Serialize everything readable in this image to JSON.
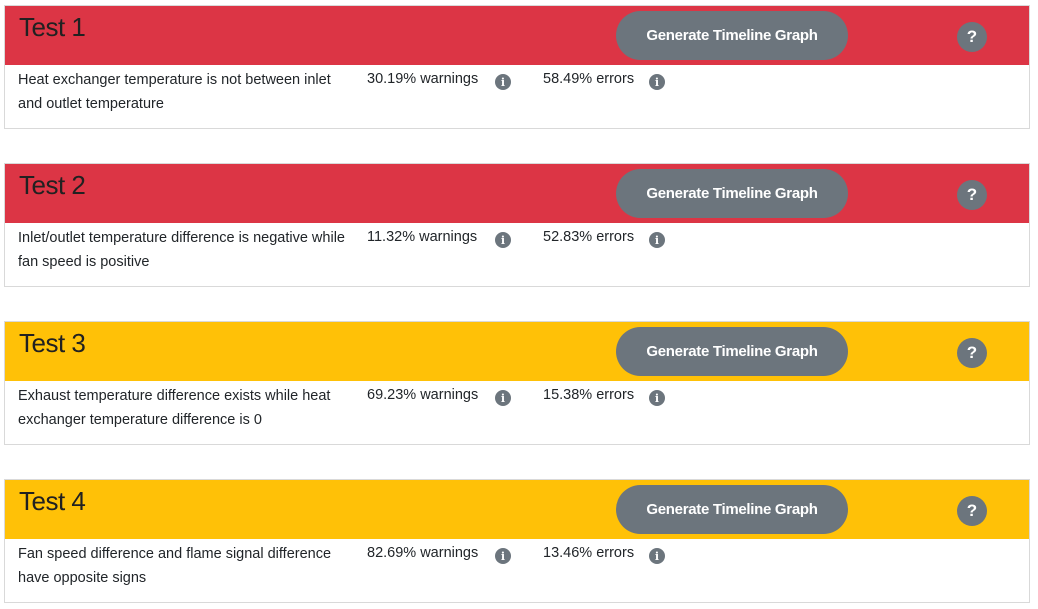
{
  "tests": [
    {
      "title": "Test 1",
      "color": "#dc3545",
      "button_label": "Generate Timeline Graph",
      "help_label": "?",
      "description": "Heat exchanger temperature is not between inlet and outlet temperature",
      "warnings": "30.19% warnings",
      "errors": "58.49% errors",
      "info_icon": "i"
    },
    {
      "title": "Test 2",
      "color": "#dc3545",
      "button_label": "Generate Timeline Graph",
      "help_label": "?",
      "description": "Inlet/outlet temperature difference is negative while fan speed is positive",
      "warnings": "11.32% warnings",
      "errors": "52.83% errors",
      "info_icon": "i"
    },
    {
      "title": "Test 3",
      "color": "#ffc107",
      "button_label": "Generate Timeline Graph",
      "help_label": "?",
      "description": "Exhaust temperature difference exists while heat exchanger temperature difference is 0",
      "warnings": "69.23% warnings",
      "errors": "15.38% errors",
      "info_icon": "i"
    },
    {
      "title": "Test 4",
      "color": "#ffc107",
      "button_label": "Generate Timeline Graph",
      "help_label": "?",
      "description": "Fan speed difference and flame signal difference have opposite signs",
      "warnings": "82.69% warnings",
      "errors": "13.46% errors",
      "info_icon": "i"
    }
  ]
}
